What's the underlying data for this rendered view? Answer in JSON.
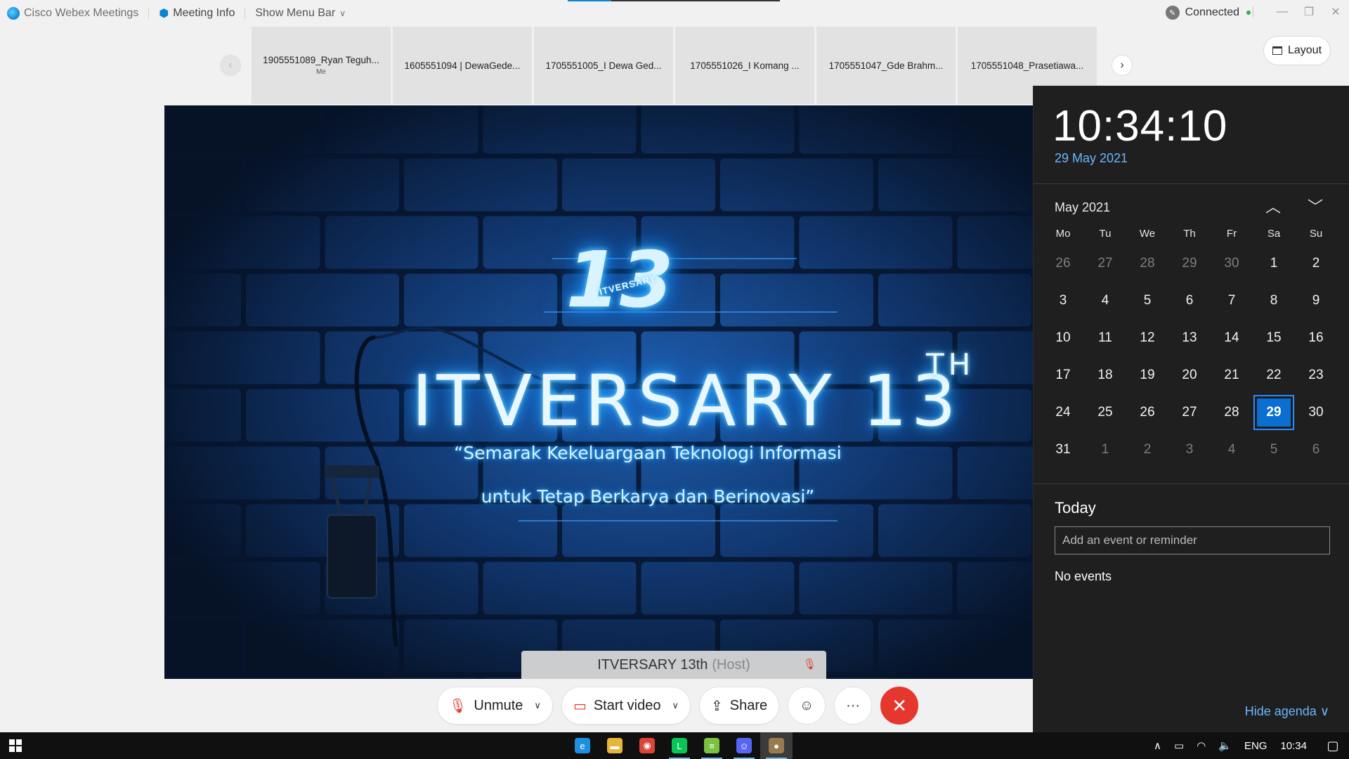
{
  "titlebar": {
    "app_name": "Cisco Webex Meetings",
    "meeting_info": "Meeting Info",
    "show_menu_bar": "Show Menu Bar",
    "connection_status": "Connected"
  },
  "participants": [
    {
      "name": "1905551089_Ryan Teguh...",
      "sub": "Me"
    },
    {
      "name": "1605551094 | DewaGede...",
      "sub": ""
    },
    {
      "name": "1705551005_I Dewa Ged...",
      "sub": ""
    },
    {
      "name": "1705551026_I Komang ...",
      "sub": ""
    },
    {
      "name": "1705551047_Gde Brahm...",
      "sub": ""
    },
    {
      "name": "1705551048_Prasetiawa...",
      "sub": ""
    }
  ],
  "layout_button": "Layout",
  "stage": {
    "logo_number": "13",
    "logo_ribbon": "ITVERSARY",
    "title": "ITVERSARY 13",
    "title_sup": "TH",
    "tagline_line1": "“Semarak Kekeluargaan Teknologi Informasi",
    "tagline_line2": "untuk Tetap Berkarya dan Berinovasi”",
    "active_speaker": "ITVERSARY 13th",
    "speaker_role": "(Host)"
  },
  "controls": {
    "unmute": "Unmute",
    "start_video": "Start video",
    "share": "Share",
    "more": "···"
  },
  "calendar": {
    "time": "10:34:10",
    "date": "29 May 2021",
    "month": "May 2021",
    "weekdays": [
      "Mo",
      "Tu",
      "We",
      "Th",
      "Fr",
      "Sa",
      "Su"
    ],
    "weeks": [
      [
        {
          "d": "26",
          "dim": true
        },
        {
          "d": "27",
          "dim": true
        },
        {
          "d": "28",
          "dim": true
        },
        {
          "d": "29",
          "dim": true
        },
        {
          "d": "30",
          "dim": true
        },
        {
          "d": "1"
        },
        {
          "d": "2"
        }
      ],
      [
        {
          "d": "3"
        },
        {
          "d": "4"
        },
        {
          "d": "5"
        },
        {
          "d": "6"
        },
        {
          "d": "7"
        },
        {
          "d": "8"
        },
        {
          "d": "9"
        }
      ],
      [
        {
          "d": "10"
        },
        {
          "d": "11"
        },
        {
          "d": "12"
        },
        {
          "d": "13"
        },
        {
          "d": "14"
        },
        {
          "d": "15"
        },
        {
          "d": "16"
        }
      ],
      [
        {
          "d": "17"
        },
        {
          "d": "18"
        },
        {
          "d": "19"
        },
        {
          "d": "20"
        },
        {
          "d": "21"
        },
        {
          "d": "22"
        },
        {
          "d": "23"
        }
      ],
      [
        {
          "d": "24"
        },
        {
          "d": "25"
        },
        {
          "d": "26"
        },
        {
          "d": "27"
        },
        {
          "d": "28"
        },
        {
          "d": "29",
          "today": true
        },
        {
          "d": "30"
        }
      ],
      [
        {
          "d": "31"
        },
        {
          "d": "1",
          "dim": true
        },
        {
          "d": "2",
          "dim": true
        },
        {
          "d": "3",
          "dim": true
        },
        {
          "d": "4",
          "dim": true
        },
        {
          "d": "5",
          "dim": true
        },
        {
          "d": "6",
          "dim": true
        }
      ]
    ],
    "today_heading": "Today",
    "event_placeholder": "Add an event or reminder",
    "no_events": "No events",
    "hide_agenda": "Hide agenda"
  },
  "taskbar": {
    "language": "ENG",
    "clock": "10:34",
    "apps": [
      {
        "icon": "edge-icon",
        "color": "#1f8fe0",
        "glyph": "e",
        "running": false
      },
      {
        "icon": "file-explorer-icon",
        "color": "#e8b53a",
        "glyph": "▬",
        "running": false
      },
      {
        "icon": "chrome-icon",
        "color": "#db4437",
        "glyph": "◉",
        "running": false
      },
      {
        "icon": "line-icon",
        "color": "#06c755",
        "glyph": "L",
        "running": true
      },
      {
        "icon": "bluestacks-icon",
        "color": "#7cc242",
        "glyph": "≡",
        "running": true
      },
      {
        "icon": "discord-icon",
        "color": "#5865f2",
        "glyph": "☺",
        "running": true
      },
      {
        "icon": "webex-icon",
        "color": "#9a7b4f",
        "glyph": "●",
        "running": true,
        "active": true
      }
    ]
  }
}
